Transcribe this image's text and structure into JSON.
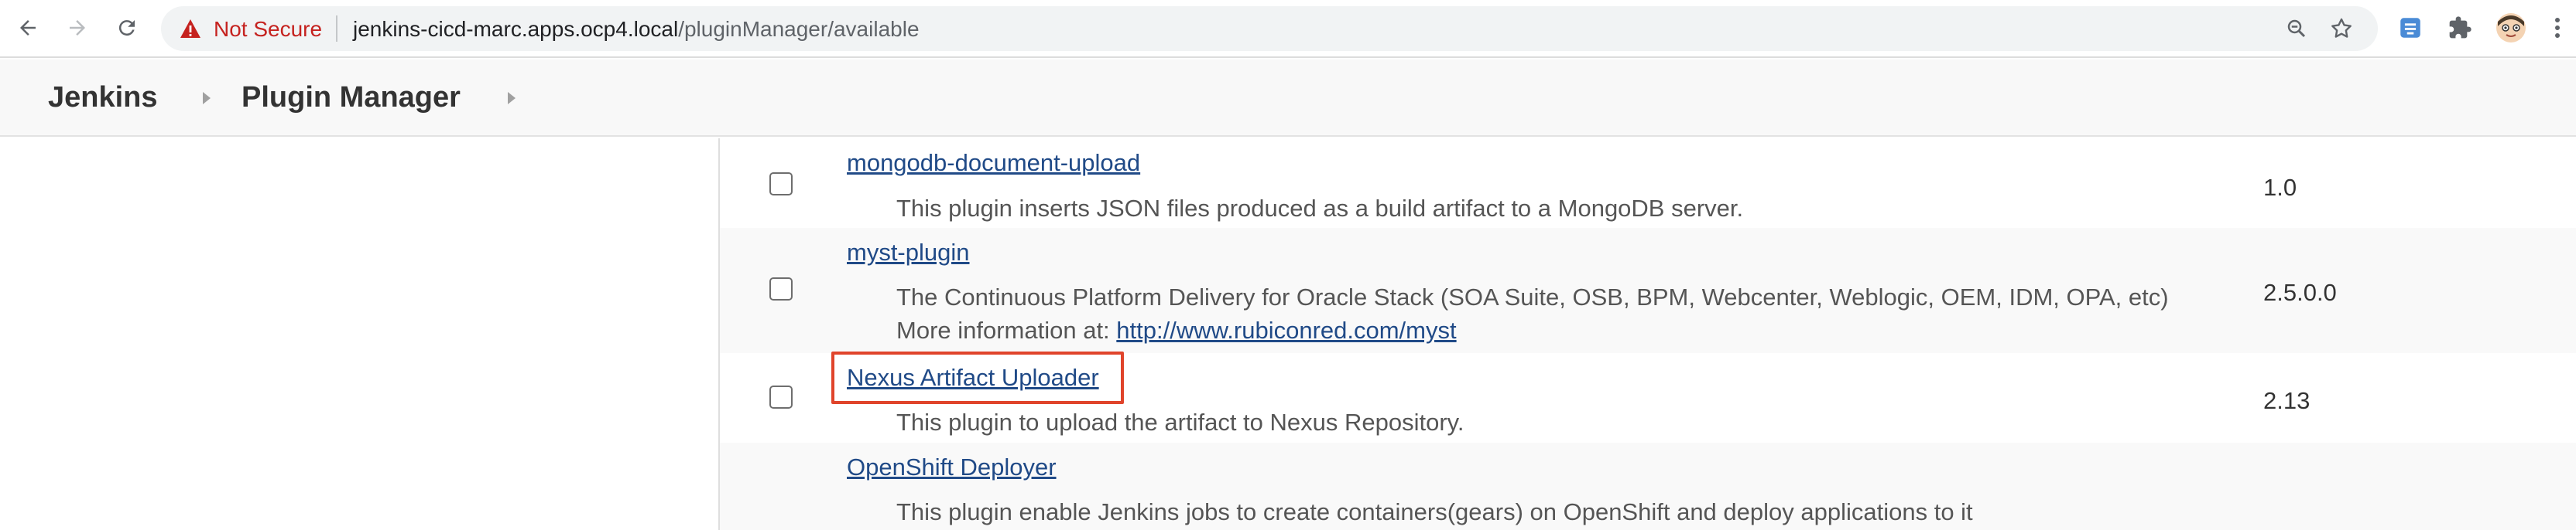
{
  "browser": {
    "security_label": "Not Secure",
    "url_host": "jenkins-cicd-marc.apps.ocp4.local",
    "url_path": "/pluginManager/available",
    "icons": [
      "back-icon",
      "forward-icon",
      "reload-icon",
      "warning-icon",
      "zoom-icon",
      "star-icon",
      "extension-badge-icon",
      "puzzle-icon",
      "profile-avatar"
    ]
  },
  "breadcrumb": {
    "items": [
      {
        "label": "Jenkins"
      },
      {
        "label": "Plugin Manager"
      }
    ]
  },
  "plugins": [
    {
      "name": "mongodb-document-upload",
      "description": "This plugin inserts JSON files produced as a build artifact to a MongoDB server.",
      "version": "1.0"
    },
    {
      "name": "myst-plugin",
      "description": "The Continuous Platform Delivery for Oracle Stack (SOA Suite, OSB, BPM, Webcenter, Weblogic, OEM, IDM, OPA, etc)",
      "more_info_label": "More information at:",
      "more_info_link": "http://www.rubiconred.com/myst",
      "version": "2.5.0.0"
    },
    {
      "name": "Nexus Artifact Uploader",
      "description": "This plugin to upload the artifact to Nexus Repository.",
      "version": "2.13",
      "highlighted": true
    },
    {
      "name": "OpenShift Deployer",
      "description": "This plugin enable Jenkins jobs to create containers(gears) on OpenShift and deploy applications to it",
      "version": ""
    }
  ],
  "colors": {
    "link": "#204a87",
    "not_secure": "#c5221f",
    "highlight_border": "#e0442b"
  }
}
